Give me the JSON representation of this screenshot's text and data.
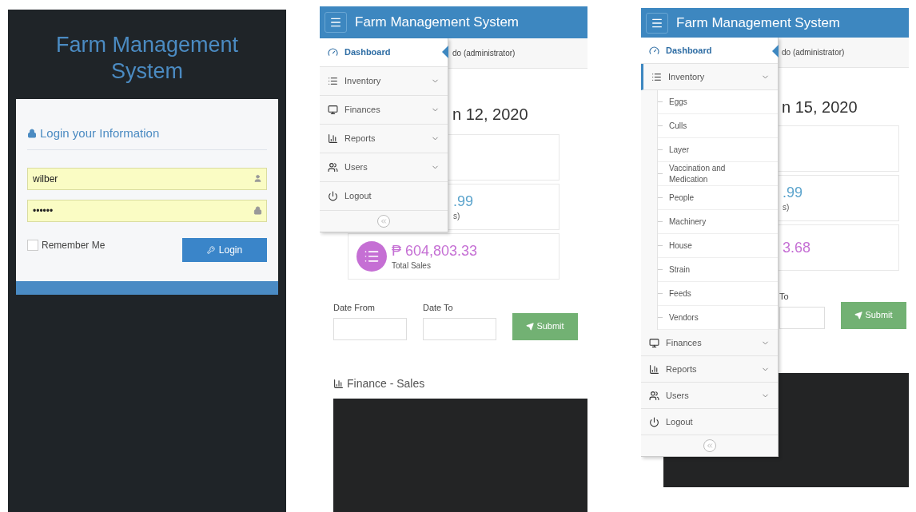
{
  "login_screen": {
    "title": "Farm Management System",
    "form_title": "Login your Information",
    "username": {
      "value": "wilber"
    },
    "password": {
      "value": "••••••"
    },
    "remember": {
      "label": "Remember Me",
      "checked": false
    },
    "login_button": "Login"
  },
  "dashboard_screens": [
    {
      "header": {
        "title": "Farm Management System"
      },
      "sidebar": {
        "items": [
          {
            "label": "Dashboard",
            "selected": true,
            "has_submenu": false,
            "expanded": false
          },
          {
            "label": "Inventory",
            "selected": false,
            "has_submenu": true,
            "expanded": false
          },
          {
            "label": "Finances",
            "selected": false,
            "has_submenu": true,
            "expanded": false
          },
          {
            "label": "Reports",
            "selected": false,
            "has_submenu": true,
            "expanded": false
          },
          {
            "label": "Users",
            "selected": false,
            "has_submenu": true,
            "expanded": false
          },
          {
            "label": "Logout",
            "selected": false,
            "has_submenu": false,
            "expanded": false
          }
        ]
      },
      "user_text": "do (administrator)",
      "date_heading": "n 12, 2020",
      "stats": [
        {
          "kind": "blank"
        },
        {
          "kind": "stat",
          "value": ".99",
          "label": "s)",
          "color": "#5aa3cc"
        },
        {
          "kind": "stat_icon",
          "value": "₱ 604,803.33",
          "label": "Total Sales",
          "color": "#c56fd4"
        }
      ],
      "filter": {
        "fields": [
          {
            "label": "Date From"
          },
          {
            "label": "Date To"
          }
        ],
        "submit": "Submit"
      },
      "chart_title": "Finance - Sales"
    },
    {
      "header": {
        "title": "Farm Management System"
      },
      "sidebar": {
        "items": [
          {
            "label": "Dashboard",
            "selected": true,
            "has_submenu": false,
            "expanded": false
          },
          {
            "label": "Inventory",
            "selected": false,
            "has_submenu": true,
            "expanded": true,
            "children": [
              {
                "label": "Eggs"
              },
              {
                "label": "Culls"
              },
              {
                "label": "Layer"
              },
              {
                "label": "Vaccination and Medication"
              },
              {
                "label": "People"
              },
              {
                "label": "Machinery"
              },
              {
                "label": "House"
              },
              {
                "label": "Strain"
              },
              {
                "label": "Feeds"
              },
              {
                "label": "Vendors"
              }
            ]
          },
          {
            "label": "Finances",
            "selected": false,
            "has_submenu": true,
            "expanded": false
          },
          {
            "label": "Reports",
            "selected": false,
            "has_submenu": true,
            "expanded": false
          },
          {
            "label": "Users",
            "selected": false,
            "has_submenu": true,
            "expanded": false
          },
          {
            "label": "Logout",
            "selected": false,
            "has_submenu": false,
            "expanded": false
          }
        ]
      },
      "user_text": "do (administrator)",
      "date_heading": "n 15, 2020",
      "stats": [
        {
          "kind": "blank"
        },
        {
          "kind": "stat",
          "value": ".99",
          "label": "s)",
          "color": "#5aa3cc"
        },
        {
          "kind": "stat",
          "value": "3.68",
          "color": "#c56fd4"
        }
      ],
      "filter": {
        "fields": [
          {
            "label": "To"
          }
        ],
        "submit": "Submit"
      }
    }
  ]
}
